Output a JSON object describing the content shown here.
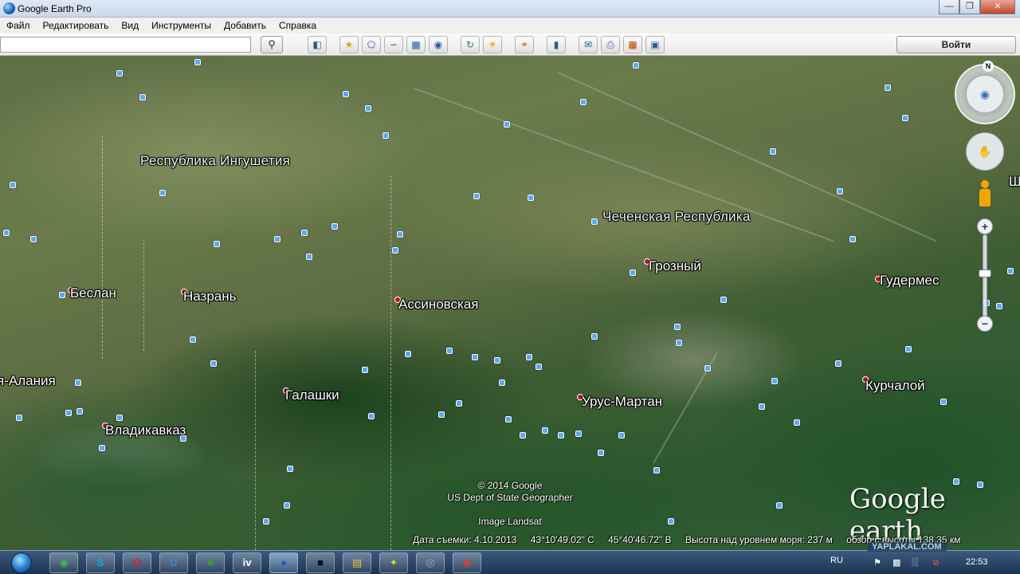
{
  "window": {
    "title": "Google Earth Pro",
    "controls": [
      "—",
      "❐",
      "✕"
    ]
  },
  "menu": [
    "Файл",
    "Редактировать",
    "Вид",
    "Инструменты",
    "Добавить",
    "Справка"
  ],
  "toolbar": {
    "search_value": "",
    "search_icon": "magnifier-icon",
    "login_label": "Войти",
    "tool_icons": [
      "sidebar-icon",
      "placemark-icon",
      "polygon-icon",
      "path-icon",
      "overlay-icon",
      "tour-icon",
      "historical-imagery-icon",
      "sunlight-icon",
      "planets-icon",
      "ruler-icon",
      "email-icon",
      "print-icon",
      "save-image-icon",
      "view-maps-icon"
    ]
  },
  "map": {
    "regions": [
      "Республика Ингушетия",
      "Чеченская Республика"
    ],
    "partial_label": "я-Алания",
    "cities": [
      "Беслан",
      "Назрань",
      "Ассиновская",
      "Грозный",
      "Гудермес",
      "Галашки",
      "Владикавказ",
      "Урус-Мартан",
      "Курчалой"
    ],
    "edge_label": "Ш",
    "copyright_lines": [
      "© 2014 Google",
      "US Dept of State Geographer",
      "Image Landsat"
    ],
    "logo": "Google earth"
  },
  "status": {
    "date": "Дата съемки: 4.10.2013",
    "lat": "43°10'49.02\" С",
    "lon": "45°40'46.72\" В",
    "elevation": "Высота над уровнем моря:   237 м",
    "eye_alt": "обзор с высоты 138.35 км"
  },
  "navigation": {
    "north_label": "N",
    "zoom_in": "+",
    "zoom_out": "−"
  },
  "taskbar": {
    "apps": [
      "chrome-icon",
      "skype-icon",
      "opera-icon",
      "d-app-icon",
      "green-app-icon",
      "ivo-app-icon",
      "google-earth-icon",
      "terminal-icon",
      "explorer-icon",
      "butterfly-icon",
      "network-icon",
      "chrome-alt-icon"
    ],
    "language": "RU",
    "clock": "22:53",
    "watermark": "YAPLAKAL.COM"
  }
}
